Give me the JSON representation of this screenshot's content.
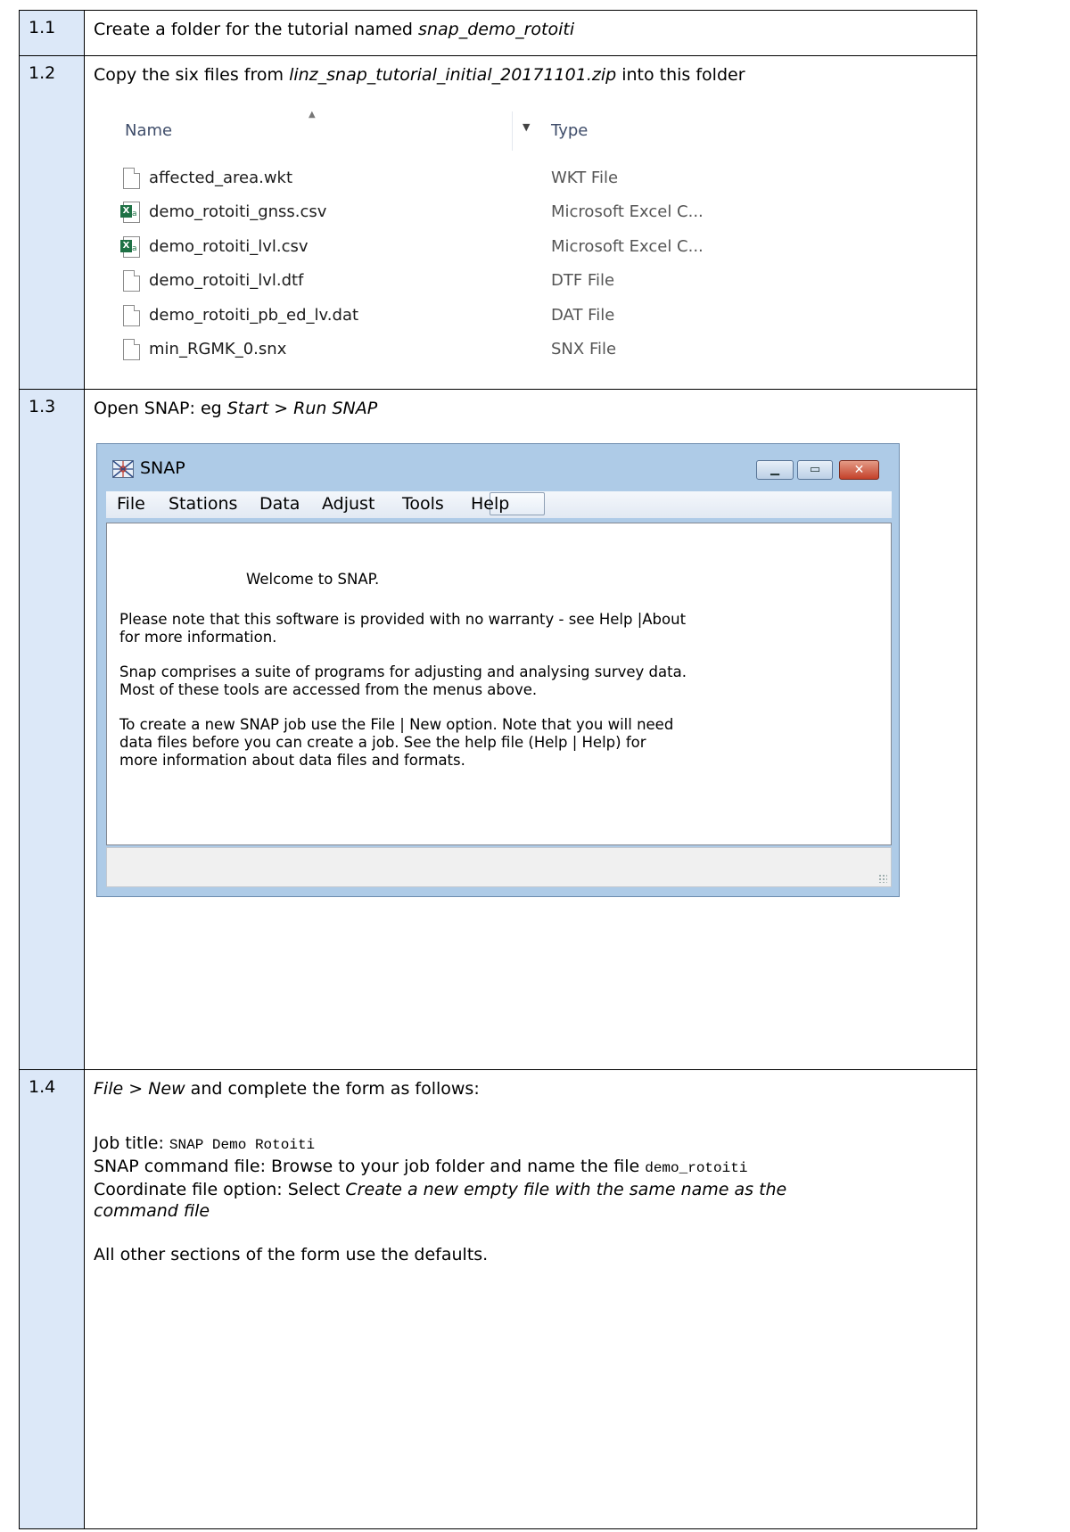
{
  "steps": [
    {
      "num": "1.1",
      "prefix": "Create a folder for the tutorial named ",
      "italic": "snap_demo_rotoiti"
    },
    {
      "num": "1.2",
      "prefix": "Copy the six files from ",
      "italic": "linz_snap_tutorial_initial_20171101.zip",
      "suffix": " into this folder"
    },
    {
      "num": "1.3",
      "prefix": "Open SNAP: eg ",
      "italic": "Start > Run SNAP"
    },
    {
      "num": "1.4",
      "line1_italic_a": "File",
      "line1_sep": " > ",
      "line1_italic_b": "New",
      "line1_rest": " and complete the form as follows:",
      "job_label": "Job title: ",
      "job_value": "SNAP Demo Rotoiti",
      "cmd_label": "SNAP command file: Browse to your job folder and name the file ",
      "cmd_value": "demo_rotoiti",
      "coord_label": "Coordinate file option: Select ",
      "coord_italic_1": "Create a new empty file with the same name as the",
      "coord_italic_2": "command file",
      "defaults": "All other sections of the form use the defaults."
    }
  ],
  "explorer": {
    "col_name": "Name",
    "col_type": "Type",
    "files": [
      {
        "name": "affected_area.wkt",
        "type": "WKT File",
        "icon": "document-icon"
      },
      {
        "name": "demo_rotoiti_gnss.csv",
        "type": "Microsoft Excel C...",
        "icon": "excel-icon"
      },
      {
        "name": "demo_rotoiti_lvl.csv",
        "type": "Microsoft Excel C...",
        "icon": "excel-icon"
      },
      {
        "name": "demo_rotoiti_lvl.dtf",
        "type": "DTF File",
        "icon": "document-icon"
      },
      {
        "name": "demo_rotoiti_pb_ed_lv.dat",
        "type": "DAT File",
        "icon": "document-icon"
      },
      {
        "name": "min_RGMK_0.snx",
        "type": "SNX File",
        "icon": "document-icon"
      }
    ]
  },
  "snap_window": {
    "title": "SNAP",
    "menu": [
      "File",
      "Stations",
      "Data",
      "Adjust",
      "Tools",
      "Help"
    ],
    "welcome": "Welcome to SNAP.",
    "para1_line1": "Please note that this software is provided with no warranty - see Help |About",
    "para1_line2": "for more information.",
    "para2_line1": "Snap comprises a suite of programs for adjusting and analysing survey data.",
    "para2_line2": "Most of these tools are accessed from the menus above.",
    "para3_line1": "To create a new SNAP job use the File | New option.  Note that you will need",
    "para3_line2": "data files before you can create a job.  See the help file (Help | Help) for",
    "para3_line3": "more information about data files and formats."
  }
}
